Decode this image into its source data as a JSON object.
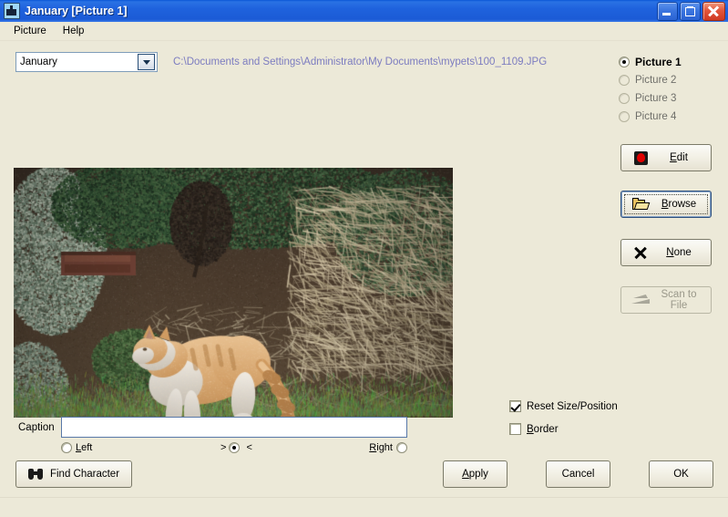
{
  "window": {
    "title": "January [Picture 1]",
    "icon": "calendar-picture-icon",
    "buttons": {
      "minimize": "minimize-icon",
      "restore": "restore-icon",
      "close": "close-icon"
    }
  },
  "menubar": {
    "items": [
      {
        "label": "Picture"
      },
      {
        "label": "Help"
      }
    ]
  },
  "month_combo": {
    "value": "January",
    "dropdown_icon": "chevron-down-icon"
  },
  "file_path": "C:\\Documents and Settings\\Administrator\\My Documents\\mypets\\100_1109.JPG",
  "picture_slots": [
    {
      "label": "Picture 1",
      "selected": true,
      "enabled": true
    },
    {
      "label": "Picture 2",
      "selected": false,
      "enabled": false
    },
    {
      "label": "Picture 3",
      "selected": false,
      "enabled": false
    },
    {
      "label": "Picture 4",
      "selected": false,
      "enabled": false
    }
  ],
  "action_buttons": [
    {
      "label": "Edit",
      "icon": "palette-icon",
      "enabled": true,
      "focused": false,
      "accel": "E"
    },
    {
      "label": "Browse",
      "icon": "folder-open-icon",
      "enabled": true,
      "focused": true,
      "accel": "B"
    },
    {
      "label": "None",
      "icon": "x-icon",
      "enabled": true,
      "focused": false,
      "accel": "N"
    },
    {
      "label": "Scan to File",
      "icon": "scanner-icon",
      "enabled": false,
      "focused": false,
      "accel": ""
    }
  ],
  "caption": {
    "label": "Caption",
    "value": "",
    "placeholder": ""
  },
  "alignment": {
    "left_label": "Left",
    "center_left_marker": ">",
    "center_right_marker": "<",
    "right_label": "Right",
    "selected": "center"
  },
  "options": [
    {
      "label": "Reset Size/Position",
      "checked": true
    },
    {
      "label": "Border",
      "checked": false
    }
  ],
  "bottom_buttons": {
    "find_character": {
      "label": "Find Character",
      "icon": "binoculars-icon"
    },
    "apply": {
      "label": "Apply"
    },
    "cancel": {
      "label": "Cancel"
    },
    "ok": {
      "label": "OK"
    }
  },
  "colors": {
    "dialog_face": "#ece9d8",
    "titlebar_blue": "#1f62dd",
    "path_text": "#7c7cc0",
    "field_border": "#5878a8",
    "edit_icon_red": "#e00000"
  },
  "photo": {
    "description": "Orange and white cat walking on bare garden soil beside shrubs and dry twigs",
    "alt": "100_1109.JPG"
  }
}
